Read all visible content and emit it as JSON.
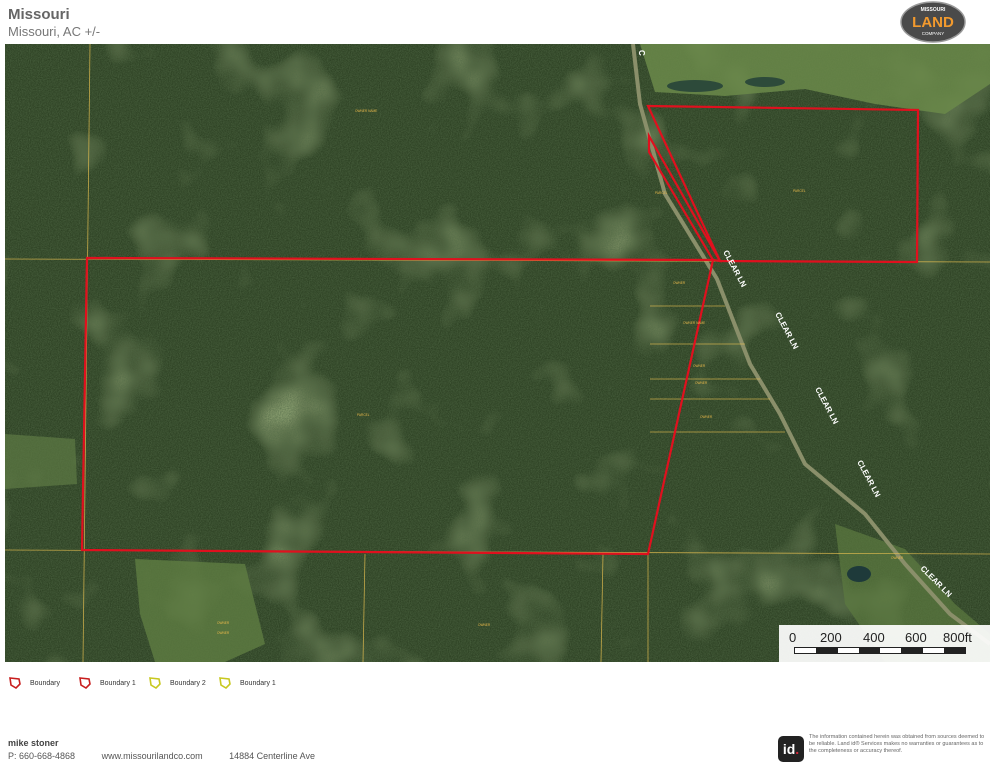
{
  "header": {
    "title": "Missouri",
    "subtitle": "Missouri,  AC +/-"
  },
  "logo": {
    "top_text": "MISSOURI",
    "main_text": "LAND",
    "bottom_text": "COMPANY"
  },
  "map": {
    "road_labels": [
      "CLEAR LN",
      "CLEAR LN",
      "CLEAR LN",
      "CLEAR LN",
      "CLEAR LN",
      "C"
    ],
    "parcel_labels": [
      "OWNER NAME",
      "PARCEL",
      "PARCEL",
      "PARCEL",
      "OWNER",
      "OWNER NAME",
      "OWNER",
      "OWNER",
      "OWNER",
      "OWNER",
      "OWNER",
      "OWNER",
      "OWNER"
    ],
    "colors": {
      "boundary": "#e0101e",
      "parcel_line": "#e8c050",
      "boundary_2": "#c8d020"
    }
  },
  "scale": {
    "labels": [
      "0",
      "200",
      "400",
      "600",
      "800ft"
    ]
  },
  "legend": {
    "items": [
      {
        "label": "Boundary",
        "color": "#c81e1e",
        "icon": "boundary-polygon-icon"
      },
      {
        "label": "Boundary 1",
        "color": "#c81e1e",
        "icon": "boundary-polygon-icon"
      },
      {
        "label": "Boundary 2",
        "color": "#c8c820",
        "icon": "boundary-polygon-icon"
      },
      {
        "label": "Boundary 1",
        "color": "#c8c820",
        "icon": "boundary-polygon-icon"
      }
    ]
  },
  "footer": {
    "name": "mike stoner",
    "phone": "P: 660-668-4868",
    "website": "www.missourilandco.com",
    "address": "14884 Centerline Ave",
    "id_logo": "id",
    "disclaimer": "The information contained herein was obtained from sources deemed to be reliable. Land id® Services makes no warranties or guarantees as to the completeness or accuracy thereof."
  }
}
